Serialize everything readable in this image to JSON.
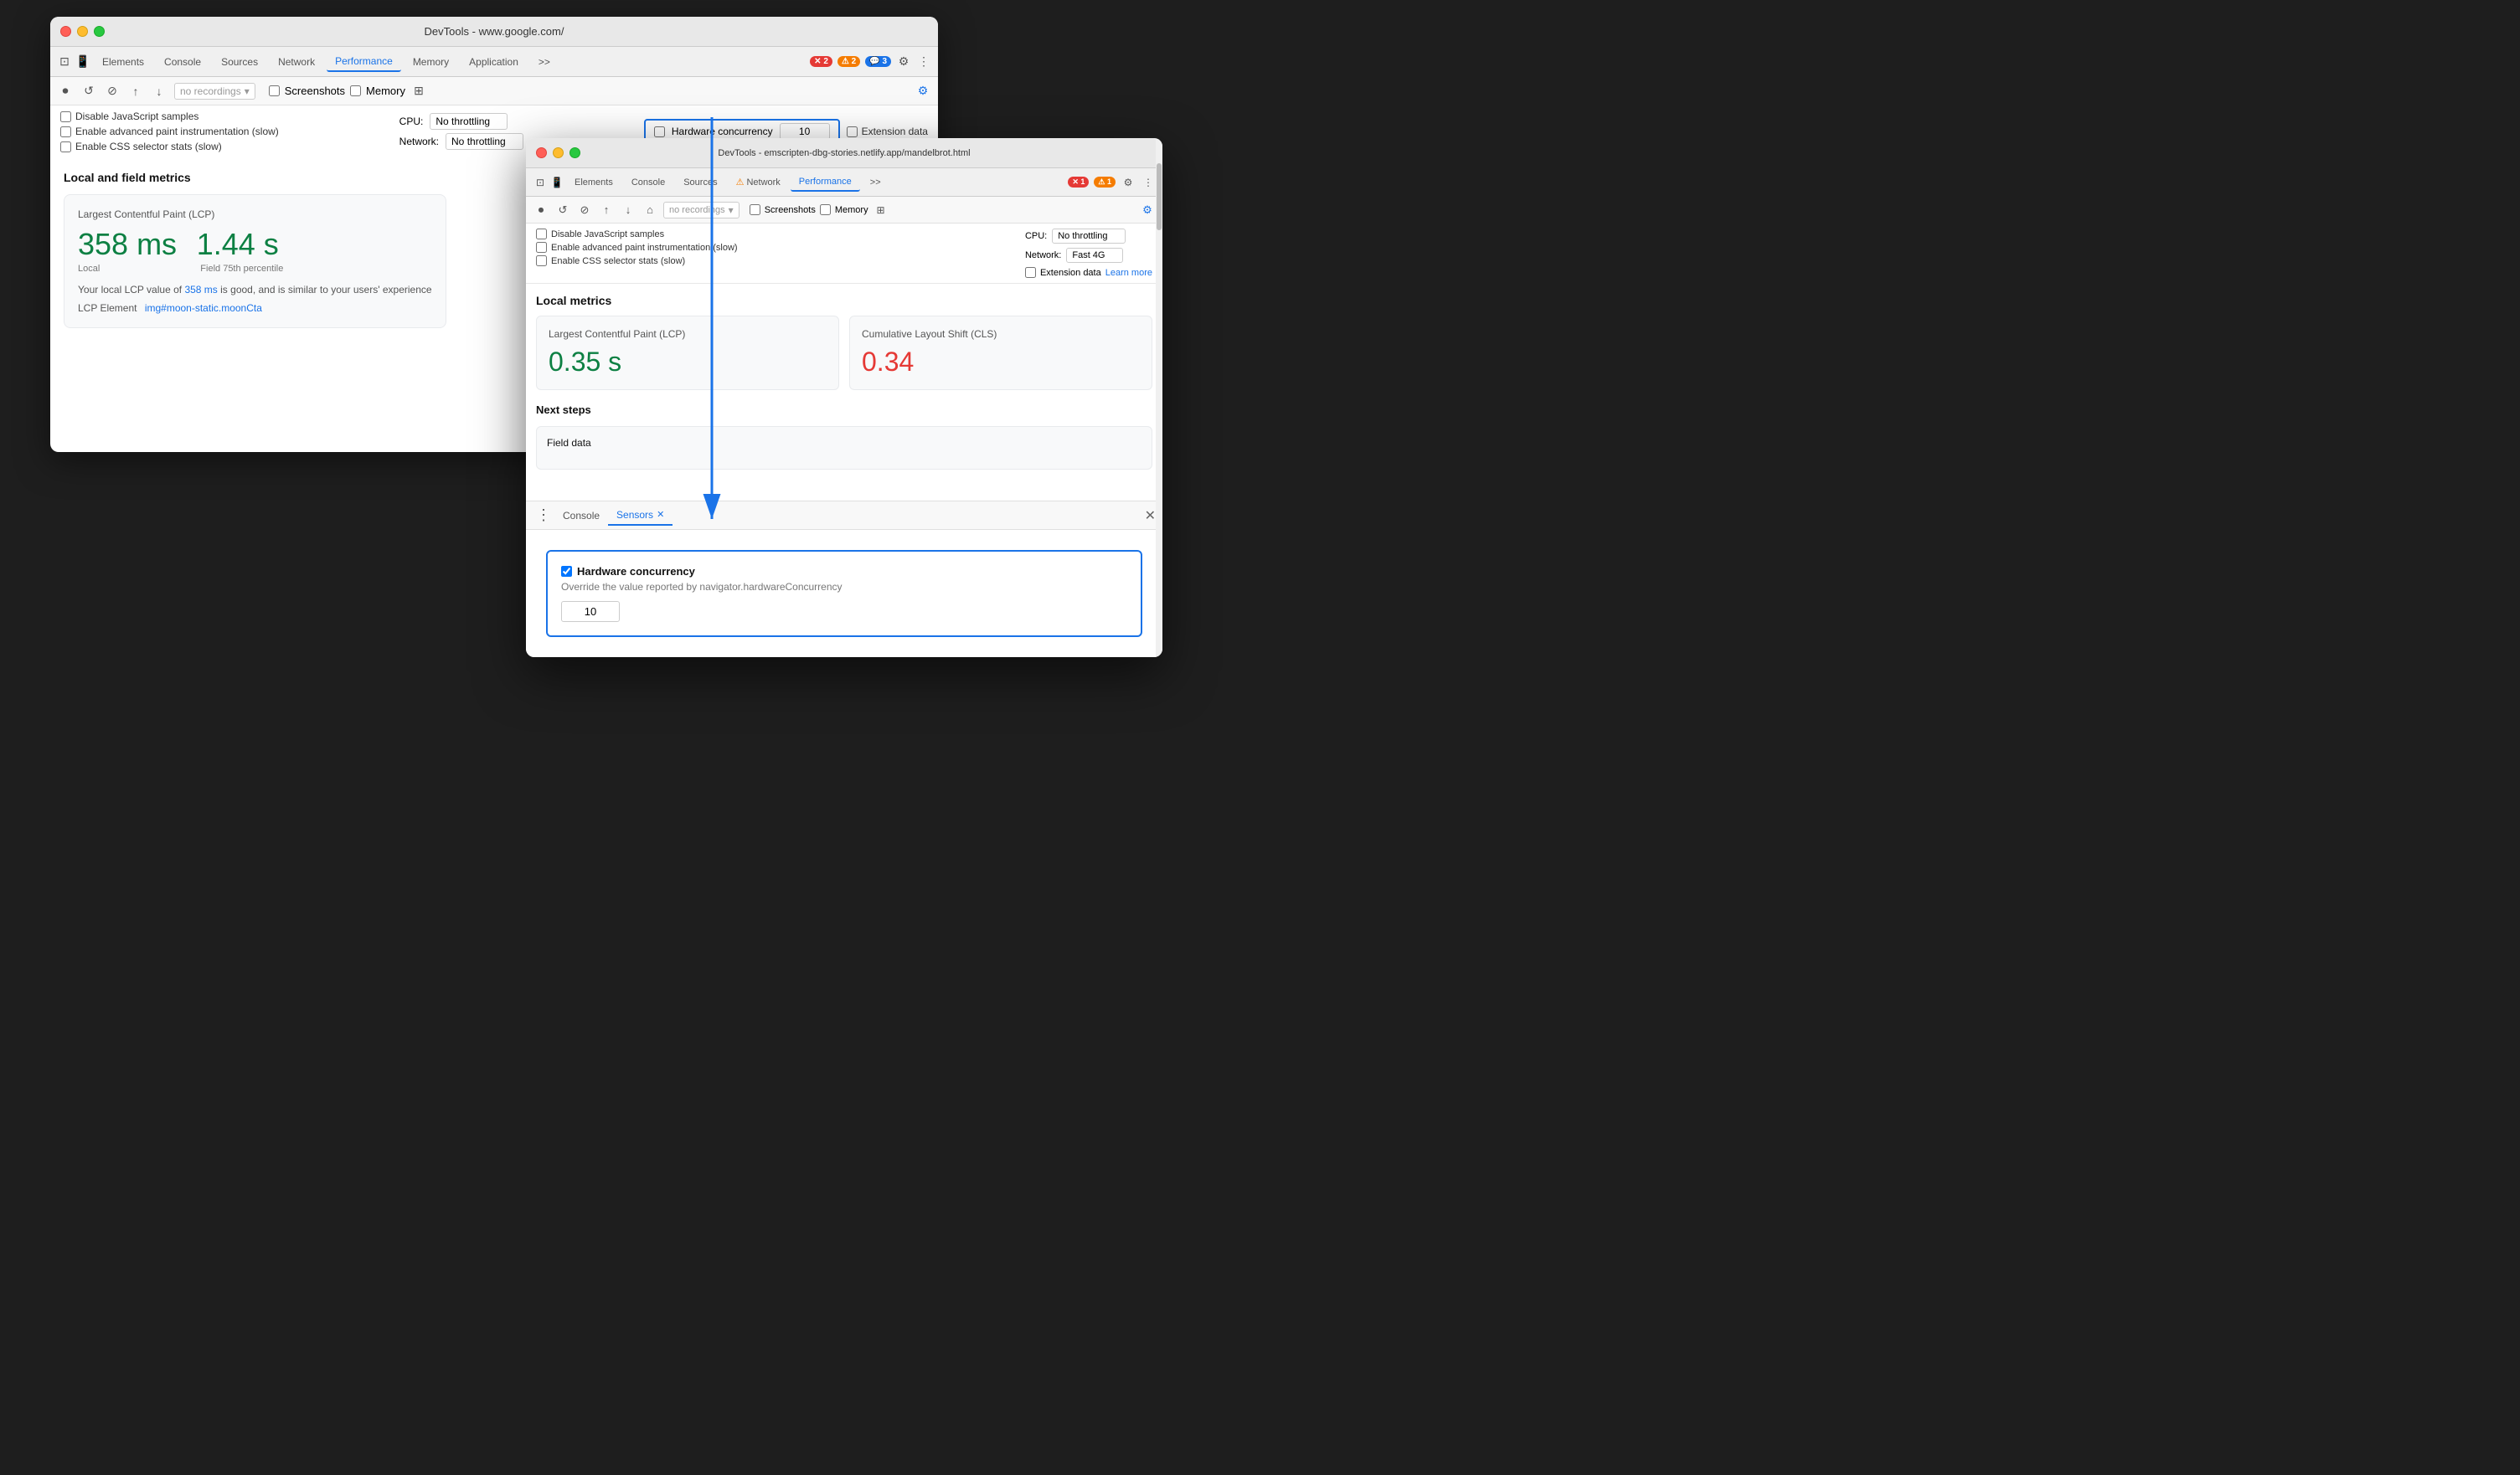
{
  "back_window": {
    "title": "DevTools - www.google.com/",
    "tabs": [
      "Elements",
      "Console",
      "Sources",
      "Network",
      "Performance",
      "Memory",
      "Application"
    ],
    "active_tab": "Performance",
    "badges": {
      "error": "2",
      "warning": "2",
      "message": "3"
    },
    "recording_placeholder": "no recordings",
    "checkboxes": {
      "disable_js": "Disable JavaScript samples",
      "enable_paint": "Enable advanced paint instrumentation (slow)",
      "enable_css": "Enable CSS selector stats (slow)",
      "screenshots": "Screenshots",
      "memory": "Memory"
    },
    "cpu_label": "CPU:",
    "cpu_value": "No throttling",
    "network_label": "Network:",
    "network_value": "No throttling",
    "hw_concurrency_label": "Hardware concurrency",
    "hw_concurrency_value": "10",
    "extension_data_label": "Extension data",
    "section_title": "Local and field metrics",
    "lcp_title": "Largest Contentful Paint (LCP)",
    "lcp_local_value": "358 ms",
    "lcp_local_label": "Local",
    "lcp_field_value": "1.44 s",
    "lcp_field_label": "Field 75th percentile",
    "lcp_description": "Your local LCP value of",
    "lcp_value_inline": "358 ms",
    "lcp_description2": "is good, and is similar to your users' experience",
    "lcp_element_label": "LCP Element",
    "lcp_element_value": "img#moon-static.moonCta"
  },
  "front_window": {
    "title": "DevTools - emscripten-dbg-stories.netlify.app/mandelbrot.html",
    "tabs": [
      "Elements",
      "Console",
      "Sources",
      "Network",
      "Performance"
    ],
    "active_tab": "Performance",
    "badges": {
      "error": "1",
      "warning": "1"
    },
    "recording_placeholder": "no recordings",
    "checkboxes": {
      "disable_js": "Disable JavaScript samples",
      "enable_paint": "Enable advanced paint instrumentation (slow)",
      "enable_css": "Enable CSS selector stats (slow)",
      "screenshots": "Screenshots",
      "memory": "Memory"
    },
    "cpu_label": "CPU:",
    "cpu_value": "No throttling",
    "network_label": "Network:",
    "network_value": "Fast 4G",
    "extension_data_label": "Extension data",
    "learn_more": "Learn more",
    "local_metrics_title": "Local metrics",
    "lcp_title": "Largest Contentful Paint (LCP)",
    "lcp_value": "0.35 s",
    "cls_title": "Cumulative Layout Shift (CLS)",
    "cls_value": "0.34",
    "next_steps_title": "Next steps",
    "field_data_title": "Field data"
  },
  "sensors_panel": {
    "tabs": [
      "Console",
      "Sensors"
    ],
    "active_tab": "Sensors",
    "hw_concurrency_title": "Hardware concurrency",
    "hw_concurrency_desc": "Override the value reported by navigator.hardwareConcurrency",
    "hw_concurrency_value": "10",
    "hw_checked": true
  },
  "arrow": {
    "color": "#1a73e8"
  }
}
